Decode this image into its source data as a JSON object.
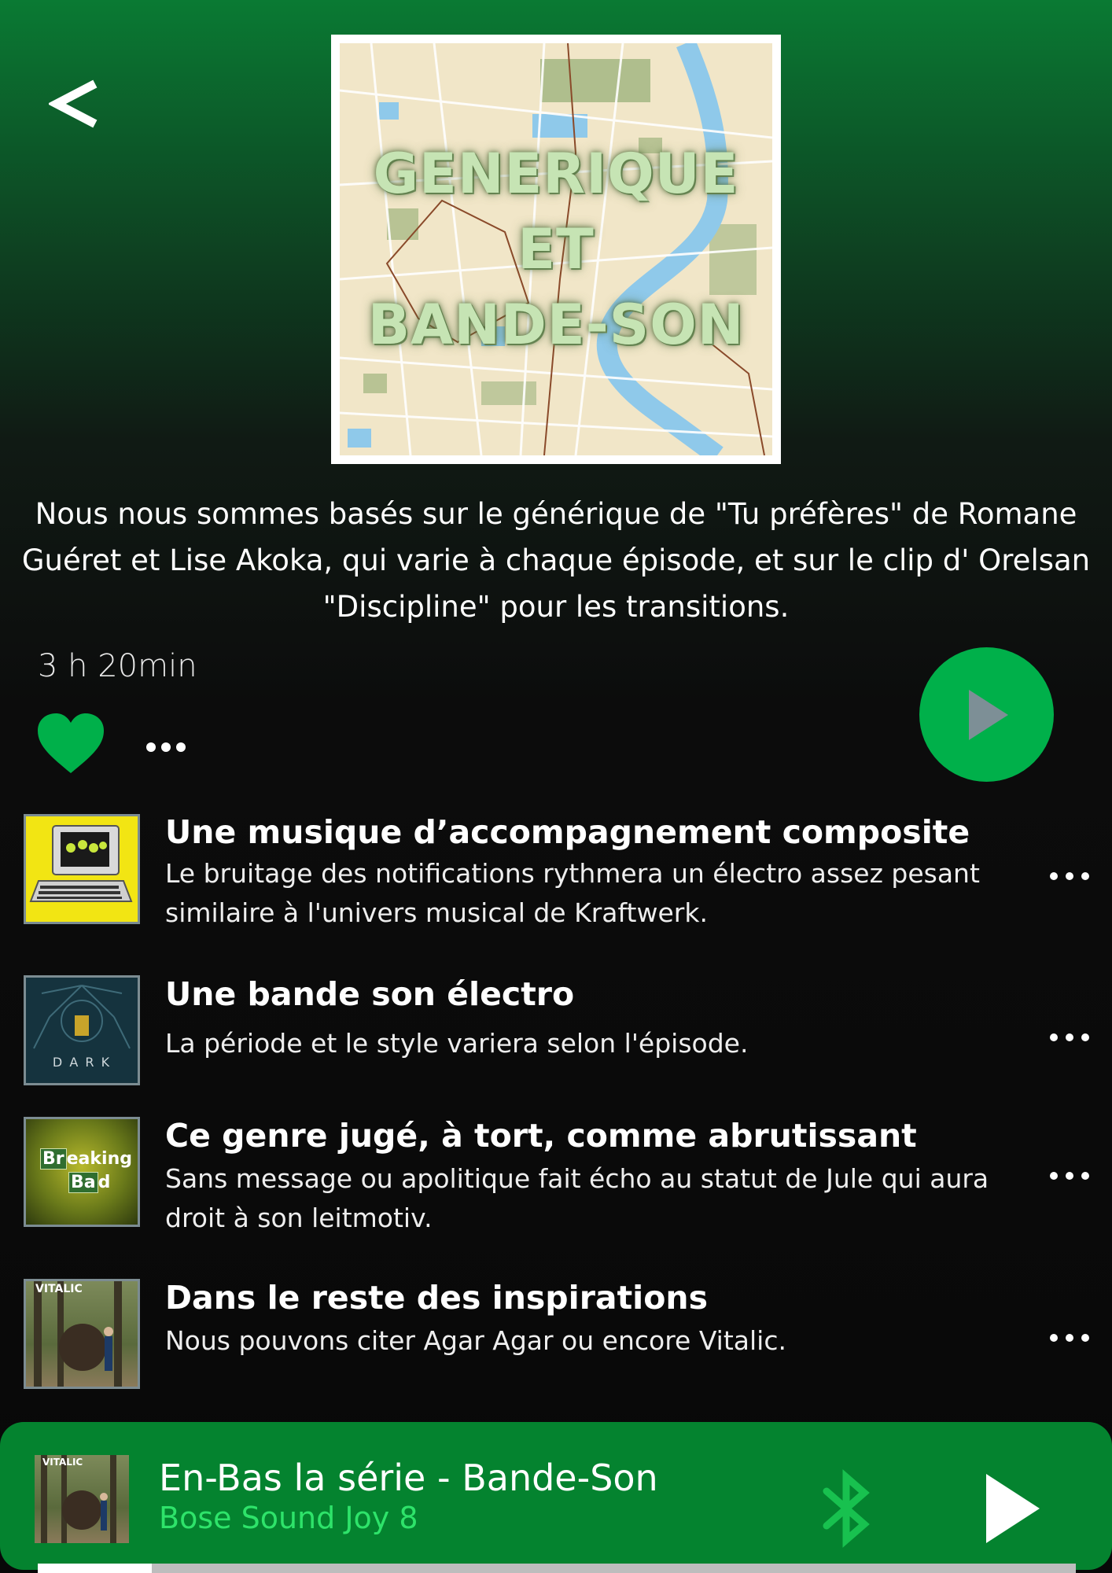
{
  "header": {
    "back_icon": "chevron-left-icon"
  },
  "cover": {
    "lines": [
      "GENERIQUE",
      "ET",
      "BANDE-SON"
    ],
    "colors": {
      "paper": "#f1e6c8",
      "river": "#8fc9ea",
      "parks": "#9fb47e"
    }
  },
  "description": "Nous nous sommes basés sur le générique de \"Tu préfères\" de Romane Guéret et Lise Akoka, qui varie à chaque épisode, et sur le clip d' Orelsan \"Discipline\" pour les transitions.",
  "duration": "3 h 20min",
  "actions": {
    "like_icon": "heart-icon",
    "more_icon": "more-dots-icon",
    "play_icon": "play-icon"
  },
  "tracks": [
    {
      "title": "Une musique d’accompagnement composite",
      "description": "Le bruitage des notifications rythmera un électro assez pesant similaire à l'univers musical de Kraftwerk.",
      "art": "kraftwerk-computer-world-art"
    },
    {
      "title": "Une bande son électro",
      "description": "La période et le style variera selon l'épisode.",
      "art": "dark-soundtrack-art",
      "art_text": "D A R K"
    },
    {
      "title": "Ce genre jugé, à tort, comme abrutissant",
      "description": "Sans message ou apolitique fait écho au statut de Jule qui aura droit à son leitmotiv.",
      "art": "breaking-bad-soundtrack-art",
      "art_text": [
        "Br",
        "eaking",
        "Ba",
        "d"
      ]
    },
    {
      "title": "Dans le reste des inspirations",
      "description": "Nous pouvons citer Agar Agar ou encore Vitalic.",
      "art": "vitalic-forest-art",
      "art_text": "VITALIC"
    }
  ],
  "player": {
    "title": "En-Bas la série - Bande-Son",
    "device": "Bose Sound Joy 8",
    "art_text": "VITALIC",
    "bluetooth_icon": "bluetooth-icon",
    "play_icon": "play-icon",
    "progress": 0.11
  },
  "colors": {
    "accent": "#00b04a",
    "player_bg": "#04832f",
    "device_text": "#2ee36a"
  }
}
